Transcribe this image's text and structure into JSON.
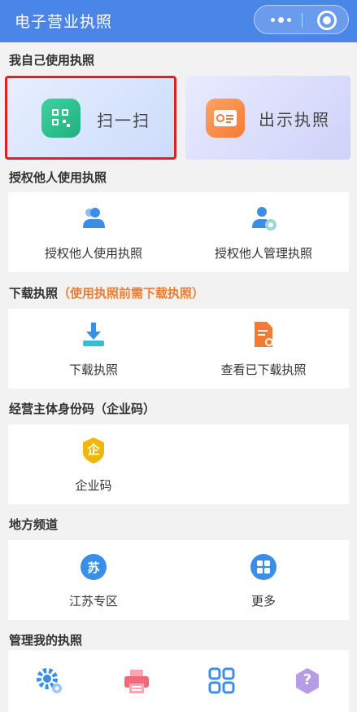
{
  "header": {
    "title": "电子营业执照"
  },
  "capsule": {
    "more_icon": "more-dots-icon",
    "close_icon": "close-target-icon"
  },
  "sections": {
    "self_use": {
      "title": "我自己使用执照"
    },
    "authorize": {
      "title": "授权他人使用执照"
    },
    "download": {
      "title": "下载执照",
      "note": "（使用执照前需下载执照）"
    },
    "identity": {
      "title": "经营主体身份码（企业码）"
    },
    "local": {
      "title": "地方频道"
    },
    "manage": {
      "title": "管理我的执照"
    }
  },
  "self_use": {
    "scan_label": "扫一扫",
    "show_label": "出示执照"
  },
  "authorize_items": [
    {
      "label": "授权他人使用执照",
      "icon": "users-icon"
    },
    {
      "label": "授权他人管理执照",
      "icon": "user-gear-icon"
    }
  ],
  "download_items": [
    {
      "label": "下载执照",
      "icon": "download-icon"
    },
    {
      "label": "查看已下载执照",
      "icon": "document-search-icon"
    }
  ],
  "identity_items": [
    {
      "label": "企业码",
      "icon": "enterprise-code-icon",
      "glyph": "企"
    }
  ],
  "local_items": [
    {
      "label": "江苏专区",
      "icon": "jiangsu-icon",
      "glyph": "苏"
    },
    {
      "label": "更多",
      "icon": "grid-more-icon"
    }
  ],
  "manage_items": [
    {
      "icon": "gear-icon"
    },
    {
      "icon": "printer-icon"
    },
    {
      "icon": "apps-grid-icon"
    },
    {
      "icon": "help-icon",
      "glyph": "?"
    }
  ],
  "colors": {
    "header": "#4a86e8",
    "accent_orange": "#ee7d2e",
    "icon_blue": "#3b8ee8",
    "icon_orange": "#f57b35",
    "icon_green": "#21b07f",
    "icon_yellow": "#f2b705",
    "icon_pink": "#f06a7a",
    "icon_purple": "#b79be6",
    "highlight_border": "#e02020"
  }
}
